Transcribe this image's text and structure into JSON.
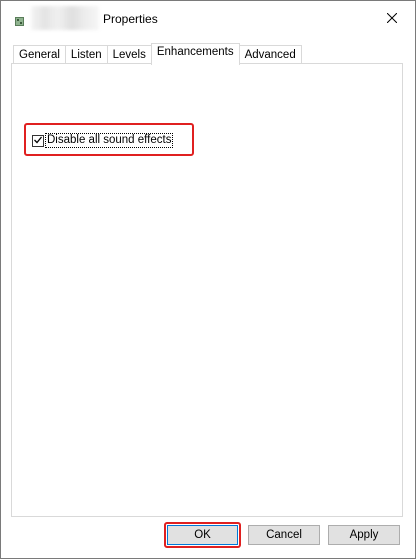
{
  "window": {
    "title": "Properties"
  },
  "tabs": [
    {
      "label": "General",
      "active": false
    },
    {
      "label": "Listen",
      "active": false
    },
    {
      "label": "Levels",
      "active": false
    },
    {
      "label": "Enhancements",
      "active": true
    },
    {
      "label": "Advanced",
      "active": false
    }
  ],
  "enhancements": {
    "disable_all_label": "Disable all sound effects",
    "disable_all_checked": true
  },
  "buttons": {
    "ok": "OK",
    "cancel": "Cancel",
    "apply": "Apply"
  },
  "colors": {
    "highlight": "#e02020",
    "focus_border": "#0078d7",
    "button_bg": "#e1e1e1"
  },
  "icons": {
    "app": "speaker-device-icon",
    "close": "close-icon",
    "check": "checkmark-icon"
  }
}
